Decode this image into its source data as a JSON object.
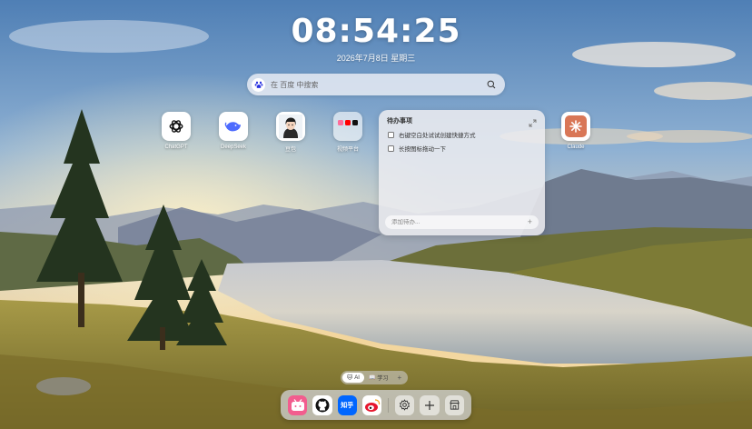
{
  "clock": {
    "time": "08:54:25",
    "date": "2026年7月8日 星期三"
  },
  "search": {
    "placeholder": "在 百度 中搜索",
    "engine_icon": "baidu-paw-icon"
  },
  "apps": [
    {
      "label": "ChatGPT",
      "icon": "chatgpt-icon"
    },
    {
      "label": "DeepSeek",
      "icon": "deepseek-whale-icon"
    },
    {
      "label": "豆包",
      "icon": "doubao-avatar-icon"
    },
    {
      "label": "视频平台",
      "icon": "video-platform-folder-icon"
    },
    {
      "label": "Claude",
      "icon": "claude-icon"
    }
  ],
  "todo": {
    "title": "待办事项",
    "items": [
      {
        "text": "右键空白处试试创建快捷方式",
        "checked": false
      },
      {
        "text": "长按图标拖动一下",
        "checked": false
      }
    ],
    "add_placeholder": "添加待办..."
  },
  "categories": [
    {
      "label": "AI",
      "icon": "cat-face-icon",
      "active": true
    },
    {
      "label": "学习",
      "icon": "book-icon",
      "active": false
    }
  ],
  "dock": [
    {
      "icon": "bilibili-icon"
    },
    {
      "icon": "github-icon"
    },
    {
      "icon": "zhihu-icon",
      "text": "知乎"
    },
    {
      "icon": "weibo-icon"
    },
    {
      "icon": "settings-gear-icon"
    },
    {
      "icon": "add-plus-icon"
    },
    {
      "icon": "store-icon"
    }
  ],
  "colors": {
    "claude_brand": "#D97757",
    "zhihu_brand": "#0066FF",
    "weibo_brand": "#E6162D",
    "deepseek_brand": "#4D6BFE",
    "baidu_brand": "#2932E1"
  }
}
